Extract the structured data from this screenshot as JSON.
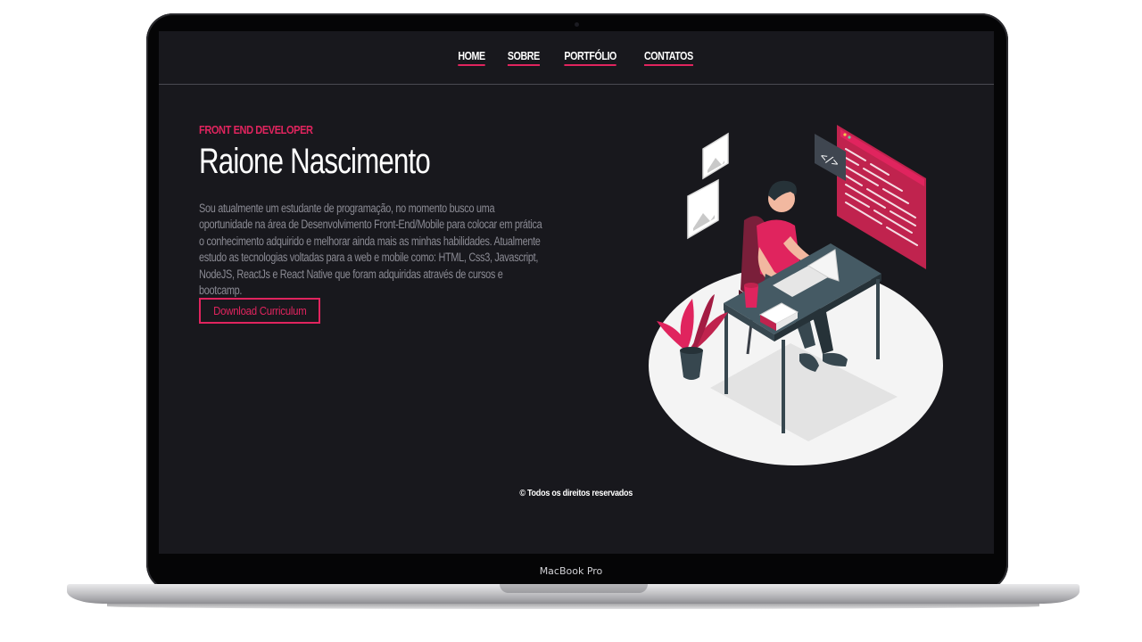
{
  "device": {
    "label": "MacBook Pro"
  },
  "nav": {
    "items": [
      {
        "label": "HOME"
      },
      {
        "label": "SOBRE"
      },
      {
        "label": "PORTFÓLIO"
      },
      {
        "label": "CONTATOS"
      }
    ]
  },
  "hero": {
    "eyebrow": "FRONT END DEVELOPER",
    "name": "Raione Nascimento",
    "bio": "Sou atualmente um estudante de programação, no momento busco uma oportunidade na área de Desenvolvimento Front-End/Mobile para colocar em prática o conhecimento adquirido e melhorar ainda mais as minhas habilidades. Atualmente estudo as tecnologias voltadas para a web e mobile como: HTML, Css3, Javascript, NodeJS, ReactJs e React Native que foram adquiridas através de cursos e bootcamp.",
    "button_label": "Download Curriculum",
    "illustration_code_symbol": "</>"
  },
  "footer": {
    "text": "© Todos os direitos reservados"
  },
  "colors": {
    "accent": "#e0245e",
    "background": "#18181d",
    "text_muted": "#8a8a93"
  }
}
